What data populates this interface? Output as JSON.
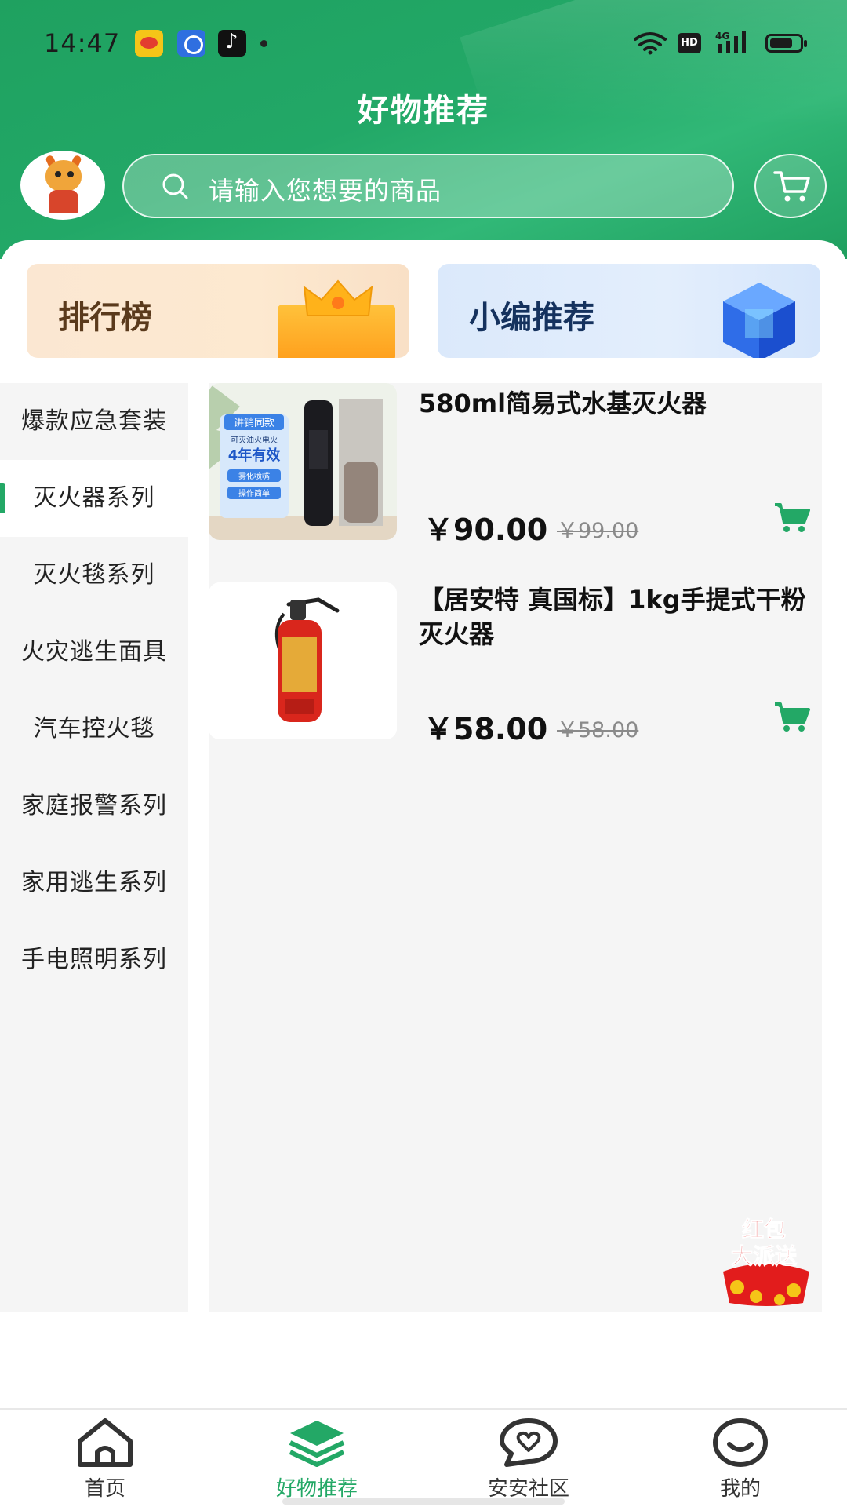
{
  "status_bar": {
    "time": "14:47",
    "hd_label": "HD",
    "network": "4G",
    "app_icons": [
      "weibo-icon",
      "baidu-icon",
      "tiktok-icon"
    ]
  },
  "header": {
    "title": "好物推荐",
    "search_placeholder": "请输入您想要的商品",
    "accent_color": "#23a866"
  },
  "banners": [
    {
      "label": "排行榜",
      "icon": "crown-icon"
    },
    {
      "label": "小编推荐",
      "icon": "cube-icon"
    }
  ],
  "categories": [
    "爆款应急套装",
    "灭火器系列",
    "灭火毯系列",
    "火灾逃生面具",
    "汽车控火毯",
    "家庭报警系列",
    "家用逃生系列",
    "手电照明系列"
  ],
  "selected_category": "灭火器系列",
  "products": [
    {
      "title": "580ml简易式水基灭火器",
      "price": "￥90.00",
      "old_price": "￥99.00",
      "image_badges": [
        "讲销同款",
        "可灭油火电火",
        "4年有效",
        "雾化喷嘴",
        "操作简单"
      ]
    },
    {
      "title": "【居安特 真国标】1kg手提式干粉灭火器",
      "price": "￥58.00",
      "old_price": "￥58.00"
    }
  ],
  "promo": {
    "line1": "红包",
    "line2": "大派送"
  },
  "tabbar": [
    {
      "label": "首页",
      "icon": "home-icon"
    },
    {
      "label": "好物推荐",
      "icon": "layers-icon",
      "active": true
    },
    {
      "label": "安安社区",
      "icon": "chat-heart-icon"
    },
    {
      "label": "我的",
      "icon": "smile-icon"
    }
  ]
}
